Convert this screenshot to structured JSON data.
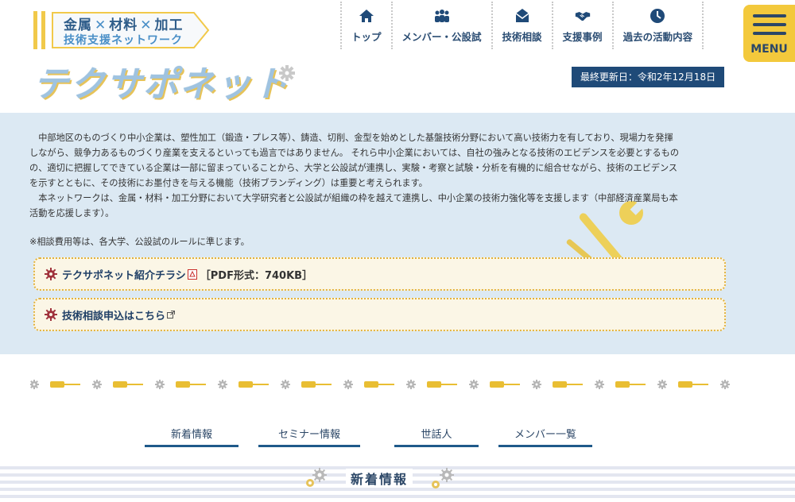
{
  "header": {
    "logo_line1_a": "金属",
    "logo_line1_b": "材料",
    "logo_line1_c": "加工",
    "logo_line2": "技術支援ネットワーク",
    "brand": "テクサポネット",
    "updated": "最終更新日：令和2年12月18日"
  },
  "nav": [
    {
      "label": "トップ",
      "icon": "home-icon"
    },
    {
      "label": "メンバー・公設試",
      "icon": "members-icon"
    },
    {
      "label": "技術相談",
      "icon": "consult-icon"
    },
    {
      "label": "支援事例",
      "icon": "handshake-icon"
    },
    {
      "label": "過去の活動内容",
      "icon": "clock-icon"
    }
  ],
  "menu_label": "MENU",
  "intro": {
    "para1_lines": [
      "　中部地区のものづくり中小企業は、塑性加工（鍛造・プレス等）、鋳造、切削、金型を始めとした基盤技術分野において高い技術力を有しており、現場力を発揮",
      "しながら、競争力あるものづくり産業を支えるといっても過言ではありません。 それら中小企業においては、自社の強みとなる技術のエビデンスを必要とするもの",
      "の、適切に把握してできている企業は一部に留まっていることから、大学と公設試が連携し、実験・考察と試験・分析を有機的に組合せながら、技術のエビデンス",
      "を示すとともに、その技術にお墨付きを与える機能（技術ブランディング）は重要と考えられます。"
    ],
    "para2_lines": [
      "　本ネットワークは、金属・材料・加工分野において大学研究者と公設試が組織の枠を越えて連携し、中小企業の技術力強化等を支援します（中部経済産業局も本",
      "活動を応援します）。"
    ],
    "note": "※相談費用等は、各大学、公設試のルールに準じます。"
  },
  "links": {
    "flyer": "テクサポネット紹介チラシ",
    "flyer_extra": "［PDF形式：740KB］",
    "apply": "技術相談申込はこちら"
  },
  "tabs": [
    "新着情報",
    "セミナー情報",
    "世話人",
    "メンバー一覧"
  ],
  "section_title": "新着情報",
  "colors": {
    "navy": "#1f4a78",
    "accent_yellow": "#f3c93c",
    "band_blue": "#dce9f3",
    "gear_red": "#a0323c"
  }
}
